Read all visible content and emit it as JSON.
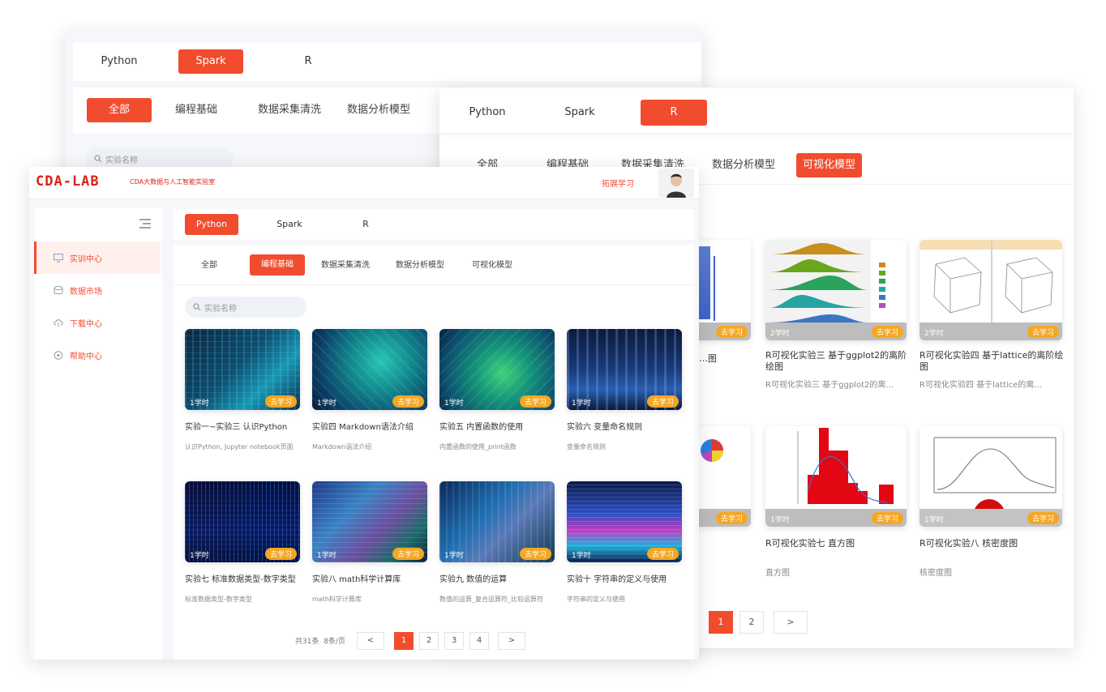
{
  "back_window": {
    "lang_tabs": [
      "Python",
      "Spark",
      "R"
    ],
    "active_lang": "Spark",
    "categories": [
      "全部",
      "编程基础",
      "数据采集清洗",
      "数据分析模型"
    ],
    "search_placeholder": "实验名称"
  },
  "right_window": {
    "lang_tabs": [
      "Python",
      "Spark",
      "R"
    ],
    "active_lang": "R",
    "categories": [
      "全部",
      "编程基础",
      "数据采集清洗",
      "数据分析模型",
      "可视化模型"
    ],
    "cards": [
      {
        "title": "…图",
        "desc": "",
        "hours": "",
        "go": "去学习"
      },
      {
        "title": "R可视化实验三 基于ggplot2的离阶绘图",
        "desc": "R可视化实验三 基于ggplot2的离…",
        "hours": "2学时",
        "go": "去学习"
      },
      {
        "title": "R可视化实验四 基于lattice的离阶绘图",
        "desc": "R可视化实验四 基于lattice的离…",
        "hours": "2学时",
        "go": "去学习"
      },
      {
        "title": "",
        "desc": "",
        "hours": "",
        "go": "去学习"
      },
      {
        "title": "R可视化实验七 直方图",
        "desc": "直方图",
        "hours": "1学时",
        "go": "去学习"
      },
      {
        "title": "R可视化实验八 核密度图",
        "desc": "核密度图",
        "hours": "1学时",
        "go": "去学习"
      }
    ],
    "pagination": [
      "1",
      "2",
      ">"
    ],
    "active_page": "1"
  },
  "front_window": {
    "logo": "CDA-LAB",
    "subtitle": "CDA大数据与人工智能实验室",
    "header_link": "拓展学习",
    "sidebar": [
      {
        "label": "实训中心",
        "icon": "monitor-icon",
        "active": true
      },
      {
        "label": "数据市场",
        "icon": "database-icon",
        "active": false
      },
      {
        "label": "下载中心",
        "icon": "cloud-download-icon",
        "active": false
      },
      {
        "label": "帮助中心",
        "icon": "help-icon",
        "active": false
      }
    ],
    "lang_tabs": [
      "Python",
      "Spark",
      "R"
    ],
    "active_lang": "Python",
    "categories": [
      "全部",
      "编程基础",
      "数据采集清洗",
      "数据分析模型",
      "可视化模型"
    ],
    "active_category": "编程基础",
    "search_placeholder": "实验名称",
    "cards": [
      {
        "title": "实验一~实验三 认识Python",
        "desc": "认识Python, Jupyter notebook页面",
        "hours": "1学时",
        "go": "去学习"
      },
      {
        "title": "实验四 Markdown语法介绍",
        "desc": "Markdown语法介绍",
        "hours": "1学时",
        "go": "去学习"
      },
      {
        "title": "实验五 内置函数的使用",
        "desc": "内置函数的使用_print函数",
        "hours": "1学时",
        "go": "去学习"
      },
      {
        "title": "实验六 变量命名规则",
        "desc": "变量命名规则",
        "hours": "1学时",
        "go": "去学习"
      },
      {
        "title": "实验七 标准数据类型-数字类型",
        "desc": "标准数据类型-数字类型",
        "hours": "1学时",
        "go": "去学习"
      },
      {
        "title": "实验八 math科学计算库",
        "desc": "math科学计算库",
        "hours": "1学时",
        "go": "去学习"
      },
      {
        "title": "实验九 数值的运算",
        "desc": "数值的运算_复合运算符_比较运算符",
        "hours": "1学时",
        "go": "去学习"
      },
      {
        "title": "实验十 字符串的定义与使用",
        "desc": "字符串的定义与使用",
        "hours": "1学时",
        "go": "去学习"
      }
    ],
    "pagination_info": "共31条  8条/页",
    "pagination": [
      "<",
      "1",
      "2",
      "3",
      "4",
      ">"
    ],
    "active_page": "1"
  },
  "colors": {
    "accent": "#f24c2e",
    "go_button": "#f5a623"
  }
}
